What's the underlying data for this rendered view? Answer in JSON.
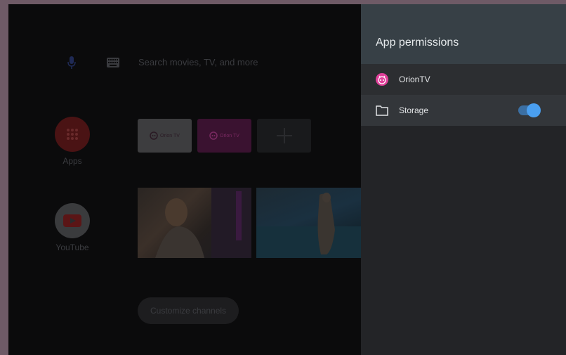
{
  "launcher": {
    "search_placeholder": "Search movies, TV, and more",
    "side_items": [
      {
        "label": "Apps",
        "icon": "apps-grid-icon"
      },
      {
        "label": "YouTube",
        "icon": "youtube-play-icon"
      }
    ],
    "tiles": [
      {
        "label": "Orion TV",
        "icon": "orion-logo-icon"
      },
      {
        "label": "Orion TV",
        "icon": "orion-logo-icon"
      },
      {
        "label": "",
        "icon": "plus-icon"
      }
    ],
    "customize_label": "Customize channels"
  },
  "panel": {
    "title": "App permissions",
    "app_name": "OrionTV",
    "permission_label": "Storage",
    "permission_enabled": true,
    "accent_color": "#4a9ff0",
    "app_icon_color": "#e0409a"
  }
}
